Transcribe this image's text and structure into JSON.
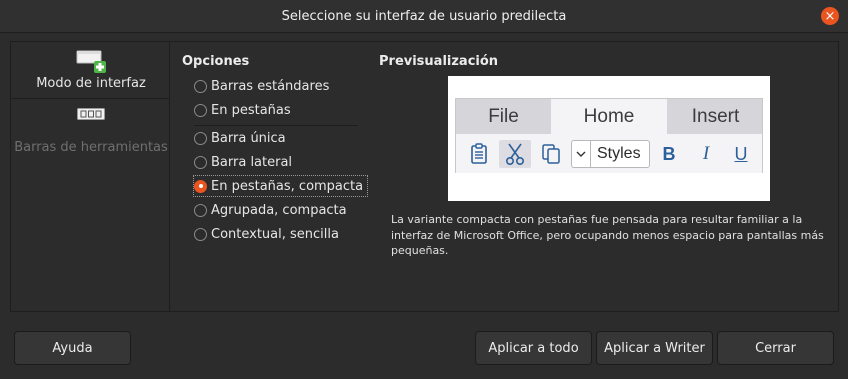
{
  "window": {
    "title": "Seleccione su interfaz de usuario predilecta",
    "close_symbol": "×"
  },
  "categories": [
    {
      "label": "Modo de interfaz",
      "icon": "interface-mode-icon",
      "active": true
    },
    {
      "label": "Barras de herramientas",
      "icon": "toolbars-icon",
      "active": false
    }
  ],
  "options": {
    "title": "Opciones",
    "items": [
      {
        "label": "Barras estándares",
        "checked": false
      },
      {
        "label": "En pestañas",
        "checked": false
      },
      {
        "label": "Barra única",
        "checked": false
      },
      {
        "label": "Barra lateral",
        "checked": false
      },
      {
        "label": "En pestañas, compacta",
        "checked": true
      },
      {
        "label": "Agrupada, compacta",
        "checked": false
      },
      {
        "label": "Contextual, sencilla",
        "checked": false
      }
    ]
  },
  "preview": {
    "title": "Previsualización",
    "tabs": [
      "File",
      "Home",
      "Insert"
    ],
    "styles_label": "Styles",
    "bold": "B",
    "italic": "I",
    "underline": "U",
    "description": "La variante compacta con pestañas fue pensada para resultar familiar a la interfaz de Microsoft Office, pero ocupando menos espacio para pantallas más pequeñas."
  },
  "buttons": {
    "help": "Ayuda",
    "apply_all": "Aplicar a todo",
    "apply_writer": "Aplicar a Writer",
    "close": "Cerrar"
  },
  "colors": {
    "accent": "#e95420",
    "background": "#2c2c2c",
    "ribbon_icon": "#2d5f9a"
  }
}
